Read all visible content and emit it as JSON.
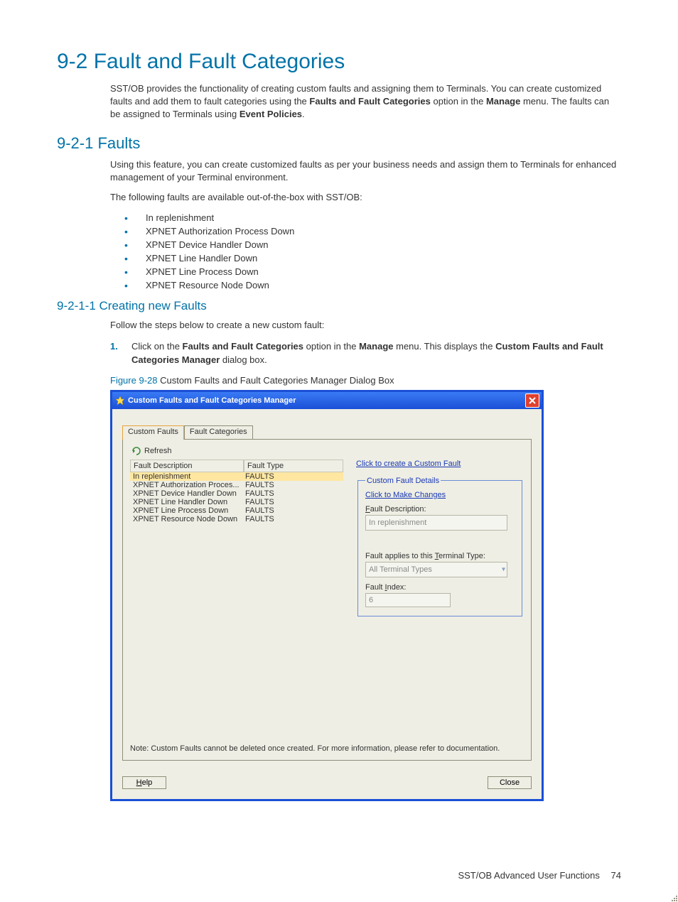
{
  "headings": {
    "h1": "9-2 Fault and Fault Categories",
    "h2": "9-2-1 Faults",
    "h3": "9-2-1-1 Creating new Faults"
  },
  "paragraphs": {
    "p1_a": "SST/OB provides the functionality of creating custom faults and assigning them to Terminals.  You can create customized faults and add them to fault categories using the ",
    "p1_b": "Faults and Fault Categories",
    "p1_c": " option in the ",
    "p1_d": "Manage",
    "p1_e": " menu.  The faults can be assigned to Terminals using ",
    "p1_f": "Event Policies",
    "p1_g": ".",
    "p2": "Using this feature, you can create customized faults as per your business needs and assign them to Terminals for enhanced management of your Terminal environment.",
    "p3": "The following faults are available out-of-the-box with SST/OB:",
    "p4": "Follow the steps below to create a new custom fault:"
  },
  "default_faults": [
    "In replenishment",
    "XPNET Authorization Process Down",
    "XPNET Device Handler Down",
    "XPNET Line Handler Down",
    "XPNET Line Process Down",
    "XPNET Resource Node Down"
  ],
  "step1": {
    "a": "Click on the ",
    "b": "Faults and Fault Categories",
    "c": " option in the ",
    "d": "Manage",
    "e": " menu.  This displays the ",
    "f": "Custom Faults and Fault Categories Manager",
    "g": " dialog box."
  },
  "figure": {
    "label": "Figure 9-28",
    "caption": " Custom Faults and Fault Categories Manager Dialog Box"
  },
  "dialog": {
    "title": "Custom Faults and Fault Categories Manager",
    "tabs": {
      "t1": "Custom Faults",
      "t2": "Fault Categories"
    },
    "refresh": "Refresh",
    "grid_headers": {
      "desc": "Fault Description",
      "type": "Fault Type"
    },
    "rows": [
      {
        "desc": "In replenishment",
        "type": "FAULTS",
        "selected": true
      },
      {
        "desc": "XPNET Authorization Proces...",
        "type": "FAULTS"
      },
      {
        "desc": "XPNET Device Handler Down",
        "type": "FAULTS"
      },
      {
        "desc": "XPNET Line Handler Down",
        "type": "FAULTS"
      },
      {
        "desc": "XPNET Line Process Down",
        "type": "FAULTS"
      },
      {
        "desc": "XPNET Resource Node Down",
        "type": "FAULTS"
      }
    ],
    "create_link": "Click to create a Custom Fault",
    "details_legend": "Custom Fault Details",
    "make_changes_link": "Click to Make Changes",
    "labels": {
      "fault_description": "Fault Description:",
      "fault_description_u": "F",
      "terminal_type": "Fault applies to this Terminal Type:",
      "terminal_type_u": "T",
      "fault_index": "Fault Index:",
      "fault_index_u": "I"
    },
    "values": {
      "fault_description": "In replenishment",
      "terminal_type": "All Terminal Types",
      "fault_index": "6"
    },
    "note": "Note: Custom Faults cannot be deleted once created. For more information, please refer to documentation.",
    "buttons": {
      "help": "Help",
      "help_u": "H",
      "close": "Close"
    }
  },
  "footer": {
    "text": "SST/OB Advanced User Functions",
    "page": "74"
  }
}
